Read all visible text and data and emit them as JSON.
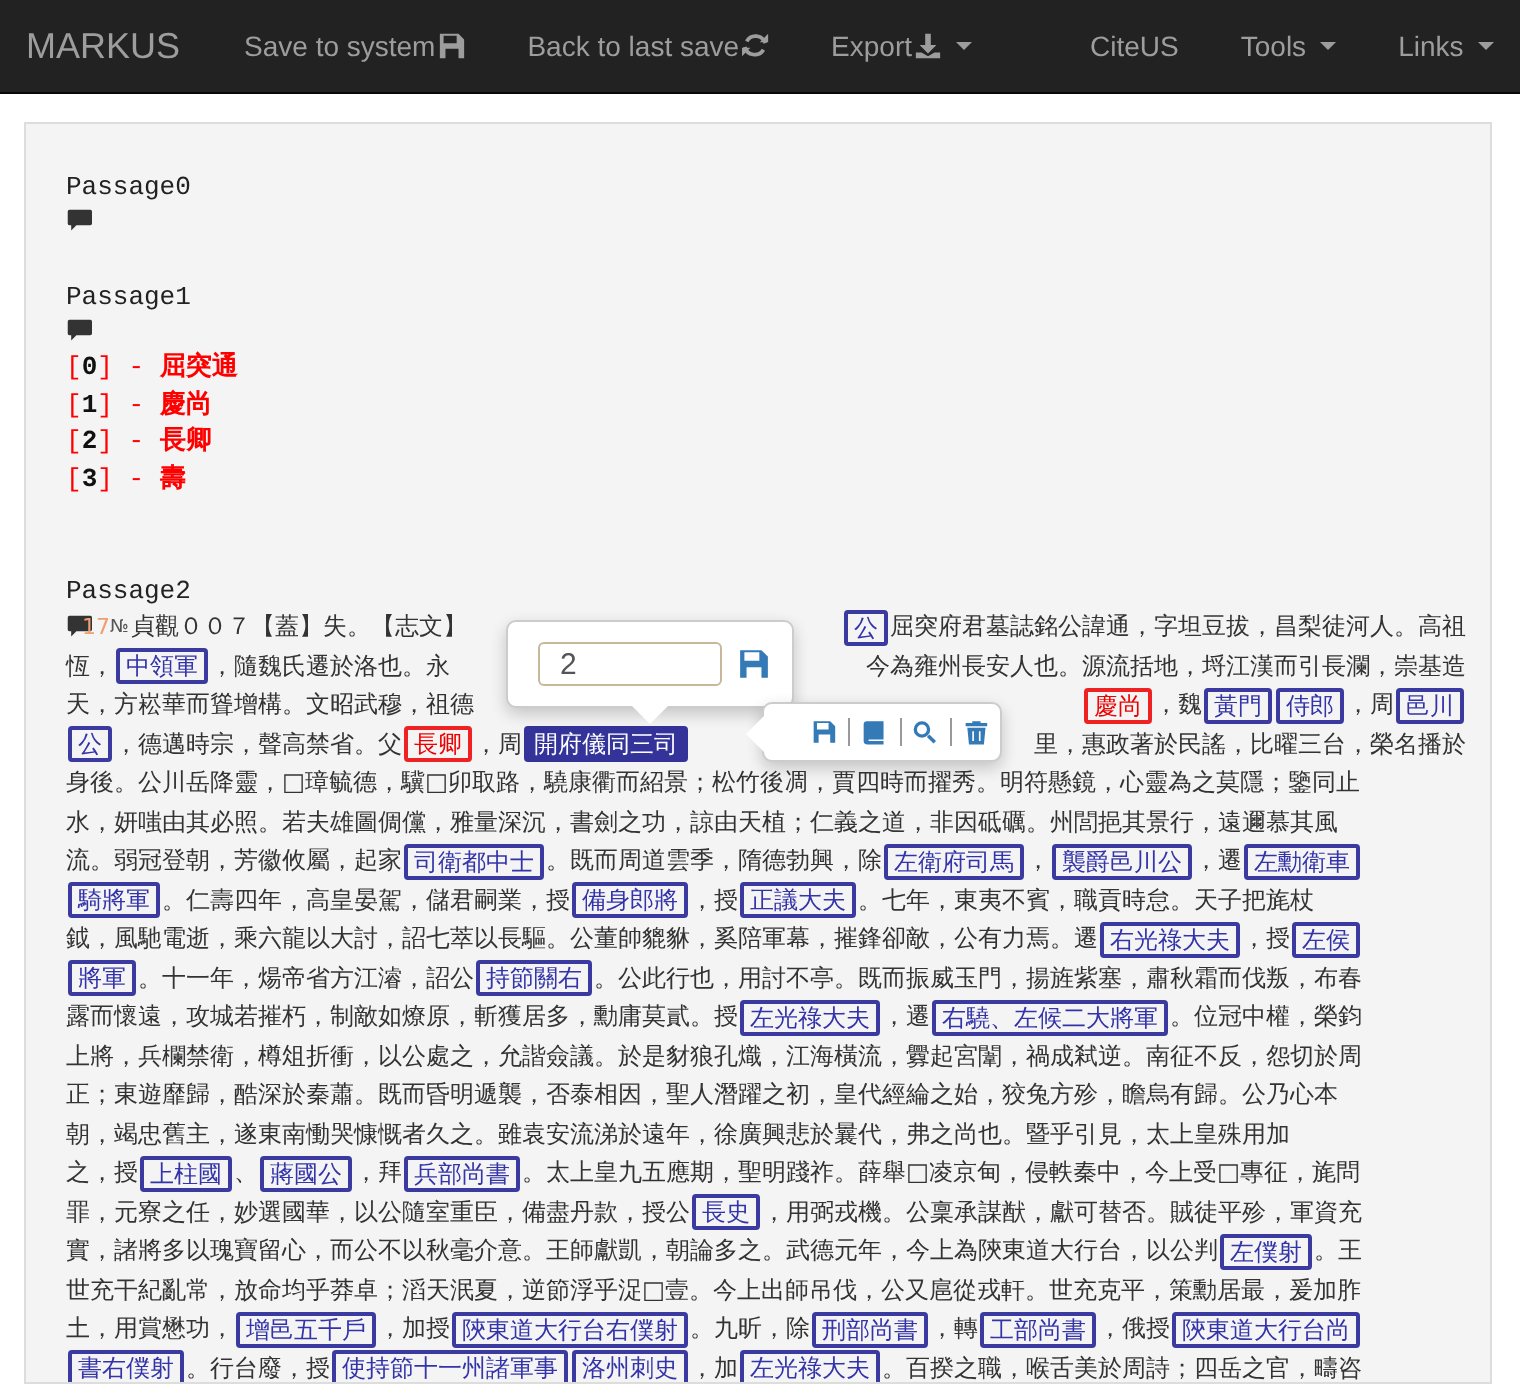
{
  "navbar": {
    "brand": "MARKUS",
    "items": [
      {
        "label": "Save to system",
        "kind": "save",
        "dropdown": false
      },
      {
        "label": "Back to last save",
        "kind": "refresh",
        "dropdown": false
      },
      {
        "label": "Export",
        "kind": "download",
        "dropdown": true
      },
      {
        "label": "CiteUS",
        "kind": "plain",
        "dropdown": false
      },
      {
        "label": "Tools",
        "kind": "plain",
        "dropdown": true
      },
      {
        "label": "Links",
        "kind": "plain",
        "dropdown": true
      }
    ]
  },
  "passages": [
    {
      "title": "Passage0"
    },
    {
      "title": "Passage1",
      "entities": [
        {
          "text": "[**0**] - **屈突通**"
        },
        {
          "text": "[**1**] - **慶尚**"
        },
        {
          "text": "[**2**] - **長卿**"
        },
        {
          "text": "[**3**] - **壽**"
        }
      ]
    },
    {
      "title": "Passage2",
      "comment_count": "17",
      "number_mark": "№",
      "lines": [
        {
          "segments": [
            {
              "kind": "text",
              "text": "貞觀００７【蓋】失。【志文】"
            },
            {
              "kind": "gap"
            },
            {
              "kind": "office",
              "text": "公",
              "selected": false
            },
            {
              "kind": "text",
              "text": "屈突府君墓誌銘公諱通，字坦豆拔，昌梨徒河人。高祖"
            }
          ]
        },
        {
          "segments": [
            {
              "kind": "text",
              "text": "恆，"
            },
            {
              "kind": "office",
              "text": "中領軍",
              "selected": false
            },
            {
              "kind": "text",
              "text": "，隨魏氏遷於洛也。永"
            },
            {
              "kind": "gap"
            },
            {
              "kind": "text",
              "text": "今為雍州長安人也。源流括地，埒江漢而引長瀾，崇基造"
            }
          ]
        },
        {
          "segments": [
            {
              "kind": "text",
              "text": "天，方崧華而聳增構。文昭武穆，祖德"
            },
            {
              "kind": "gap"
            },
            {
              "kind": "person",
              "text": "慶尚",
              "selected": false
            },
            {
              "kind": "text",
              "text": "，魏"
            },
            {
              "kind": "office",
              "text": "黃門",
              "selected": false
            },
            {
              "kind": "office",
              "text": "侍郎",
              "selected": false
            },
            {
              "kind": "text",
              "text": "，周"
            },
            {
              "kind": "office",
              "text": "邑川",
              "selected": false
            }
          ]
        },
        {
          "segments": [
            {
              "kind": "office",
              "text": "公",
              "selected": false
            },
            {
              "kind": "text",
              "text": "，德邁時宗，聲高禁省。父"
            },
            {
              "kind": "person",
              "text": "長卿",
              "selected": false
            },
            {
              "kind": "text",
              "text": "，周"
            },
            {
              "kind": "office",
              "text": "開府儀同三司",
              "selected": true
            },
            {
              "kind": "gap"
            },
            {
              "kind": "text",
              "text": "里，惠政著於民謠，比曜三台，榮名播於"
            }
          ]
        },
        {
          "segments": [
            {
              "kind": "text",
              "text": "身後。公川岳降靈，□璋毓德，驥□卯取路，驍康衢而紹景；松竹後凋，賈四時而擢秀。明符懸鏡，心靈為之莫隱；鑒同止"
            }
          ]
        },
        {
          "segments": [
            {
              "kind": "text",
              "text": "水，妍嗤由其必照。若夫雄圖倜儻，雅量深沉，書劍之功，諒由天植；仁義之道，非因砥礪。州閭挹其景行，遠邇慕其風"
            }
          ]
        },
        {
          "segments": [
            {
              "kind": "text",
              "text": "流。弱冠登朝，芳徽攸屬，起家"
            },
            {
              "kind": "office",
              "text": "司衛都中士",
              "selected": false
            },
            {
              "kind": "text",
              "text": "。既而周道雲季，隋德勃興，除"
            },
            {
              "kind": "office",
              "text": "左衛府司馬",
              "selected": false
            },
            {
              "kind": "text",
              "text": "，"
            },
            {
              "kind": "office",
              "text": "襲爵邑川公",
              "selected": false
            },
            {
              "kind": "text",
              "text": "，遷"
            },
            {
              "kind": "office",
              "text": "左勳衛車",
              "selected": false
            }
          ]
        },
        {
          "segments": [
            {
              "kind": "office",
              "text": "騎將軍",
              "selected": false
            },
            {
              "kind": "text",
              "text": "。仁壽四年，高皇晏駕，儲君嗣業，授"
            },
            {
              "kind": "office",
              "text": "備身郎將",
              "selected": false
            },
            {
              "kind": "text",
              "text": "，授"
            },
            {
              "kind": "office",
              "text": "正議大夫",
              "selected": false
            },
            {
              "kind": "text",
              "text": "。七年，東夷不賓，職貢時怠。天子把旄杖"
            }
          ]
        },
        {
          "segments": [
            {
              "kind": "text",
              "text": "鉞，風馳電逝，乘六龍以大討，詔七萃以長驅。公董帥貔貅，奚陪軍幕，摧鋒卻敵，公有力焉。遷"
            },
            {
              "kind": "office",
              "text": "右光祿大夫",
              "selected": false
            },
            {
              "kind": "text",
              "text": "，授"
            },
            {
              "kind": "office",
              "text": "左侯",
              "selected": false
            }
          ]
        },
        {
          "segments": [
            {
              "kind": "office",
              "text": "將軍",
              "selected": false
            },
            {
              "kind": "text",
              "text": "。十一年，煬帝省方江濬，詔公"
            },
            {
              "kind": "office",
              "text": "持節關右",
              "selected": false
            },
            {
              "kind": "text",
              "text": "。公此行也，用討不亭。既而振威玉門，揚旌紫塞，肅秋霜而伐叛，布春"
            }
          ]
        },
        {
          "segments": [
            {
              "kind": "text",
              "text": "露而懷遠，攻城若摧朽，制敵如燎原，斬獲居多，勳庸莫貳。授"
            },
            {
              "kind": "office",
              "text": "左光祿大夫",
              "selected": false
            },
            {
              "kind": "text",
              "text": "，遷"
            },
            {
              "kind": "office",
              "text": "右驍、左候二大將軍",
              "selected": false
            },
            {
              "kind": "text",
              "text": "。位冠中權，榮鈞"
            }
          ]
        },
        {
          "segments": [
            {
              "kind": "text",
              "text": "上將，兵欄禁衛，樽俎折衝，以公處之，允諧僉議。於是豺狼孔熾，江海橫流，釁起宮闈，禍成弒逆。南征不反，怨切於周"
            }
          ]
        },
        {
          "segments": [
            {
              "kind": "text",
              "text": "正；東遊靡歸，酷深於秦蕭。既而昏明遞襲，否泰相因，聖人潛躍之初，皇代經綸之始，狡兔方殄，瞻烏有歸。公乃心本"
            }
          ]
        },
        {
          "segments": [
            {
              "kind": "text",
              "text": "朝，竭忠舊主，遂東南慟哭慷慨者久之。雖袁安流涕於遠年，徐廣興悲於曩代，弗之尚也。暨乎引見，太上皇殊用加"
            }
          ]
        },
        {
          "segments": [
            {
              "kind": "text",
              "text": "之，授"
            },
            {
              "kind": "office",
              "text": "上柱國",
              "selected": false
            },
            {
              "kind": "text",
              "text": "、"
            },
            {
              "kind": "office",
              "text": "蔣國公",
              "selected": false
            },
            {
              "kind": "text",
              "text": "，拜"
            },
            {
              "kind": "office",
              "text": "兵部尚書",
              "selected": false
            },
            {
              "kind": "text",
              "text": "。太上皇九五應期，聖明踐祚。薛舉□凌京甸，侵軼秦中，今上受□專征，旄問"
            }
          ]
        },
        {
          "segments": [
            {
              "kind": "text",
              "text": "罪，元寮之任，妙選國華，以公隨室重臣，備盡丹款，授公"
            },
            {
              "kind": "office",
              "text": "長史",
              "selected": false
            },
            {
              "kind": "text",
              "text": "，用弼戎機。公稟承謀猷，獻可替否。賊徒平殄，軍資充"
            }
          ]
        },
        {
          "segments": [
            {
              "kind": "text",
              "text": "實，諸將多以瑰寶留心，而公不以秋毫介意。王師獻凱，朝論多之。武德元年，今上為陝東道大行台，以公判"
            },
            {
              "kind": "office",
              "text": "左僕射",
              "selected": false
            },
            {
              "kind": "text",
              "text": "。王"
            }
          ]
        },
        {
          "segments": [
            {
              "kind": "text",
              "text": "世充干紀亂常，放命均乎莽卓；滔天泯夏，逆節浮乎浞□壹。今上出師吊伐，公又扈從戎軒。世充克平，策勳居最，爰加胙"
            }
          ]
        },
        {
          "segments": [
            {
              "kind": "text",
              "text": "土，用賞懋功，"
            },
            {
              "kind": "office",
              "text": "增邑五千戶",
              "selected": false
            },
            {
              "kind": "text",
              "text": "，加授"
            },
            {
              "kind": "office",
              "text": "陝東道大行台右僕射",
              "selected": false
            },
            {
              "kind": "text",
              "text": "。九昕，除"
            },
            {
              "kind": "office",
              "text": "刑部尚書",
              "selected": false
            },
            {
              "kind": "text",
              "text": "，轉"
            },
            {
              "kind": "office",
              "text": "工部尚書",
              "selected": false
            },
            {
              "kind": "text",
              "text": "，俄授"
            },
            {
              "kind": "office",
              "text": "陝東道大行台尚",
              "selected": false
            }
          ]
        },
        {
          "segments": [
            {
              "kind": "office",
              "text": "書右僕射",
              "selected": false
            },
            {
              "kind": "text",
              "text": "。行台廢，授"
            },
            {
              "kind": "office",
              "text": "使持節十一州諸軍事",
              "selected": false
            },
            {
              "kind": "office",
              "text": "洛州刺史",
              "selected": false
            },
            {
              "kind": "text",
              "text": "，加"
            },
            {
              "kind": "office",
              "text": "左光祿大夫",
              "selected": false
            },
            {
              "kind": "text",
              "text": "。百揆之職，喉舌美於周詩；四岳之官，疇咨"
            }
          ]
        }
      ]
    }
  ],
  "edit_popup": {
    "value": "2"
  },
  "tag_toolbar": {
    "buttons": [
      {
        "kind": "save"
      },
      {
        "kind": "notes"
      },
      {
        "kind": "search"
      },
      {
        "kind": "delete"
      }
    ]
  }
}
